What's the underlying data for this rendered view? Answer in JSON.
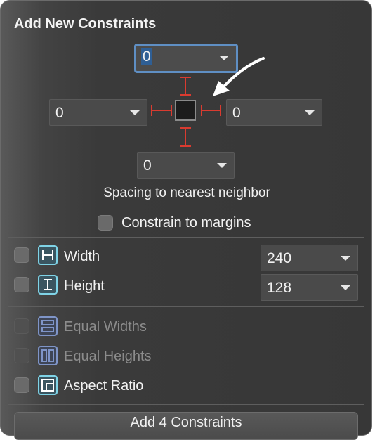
{
  "panel": {
    "title": "Add New Constraints",
    "spacing": {
      "top": {
        "value": "0"
      },
      "left": {
        "value": "0"
      },
      "right": {
        "value": "0"
      },
      "bottom": {
        "value": "0"
      }
    },
    "spacing_hint": "Spacing to nearest neighbor",
    "constrain_to_margins_label": "Constrain to margins",
    "width": {
      "label": "Width",
      "value": "240"
    },
    "height": {
      "label": "Height",
      "value": "128"
    },
    "equal_widths_label": "Equal Widths",
    "equal_heights_label": "Equal Heights",
    "aspect_ratio_label": "Aspect Ratio",
    "add_button_label": "Add 4 Constraints"
  },
  "colors": {
    "connector_red": "#d93b30",
    "focus_blue": "#5f8fc4",
    "icon_cyan": "#7fd3e6",
    "icon_blue_disabled": "#7f95c8"
  },
  "icons": [
    "arrow-annotation-icon",
    "width-constraint-icon",
    "height-constraint-icon",
    "equal-widths-icon",
    "equal-heights-icon",
    "aspect-ratio-icon"
  ]
}
